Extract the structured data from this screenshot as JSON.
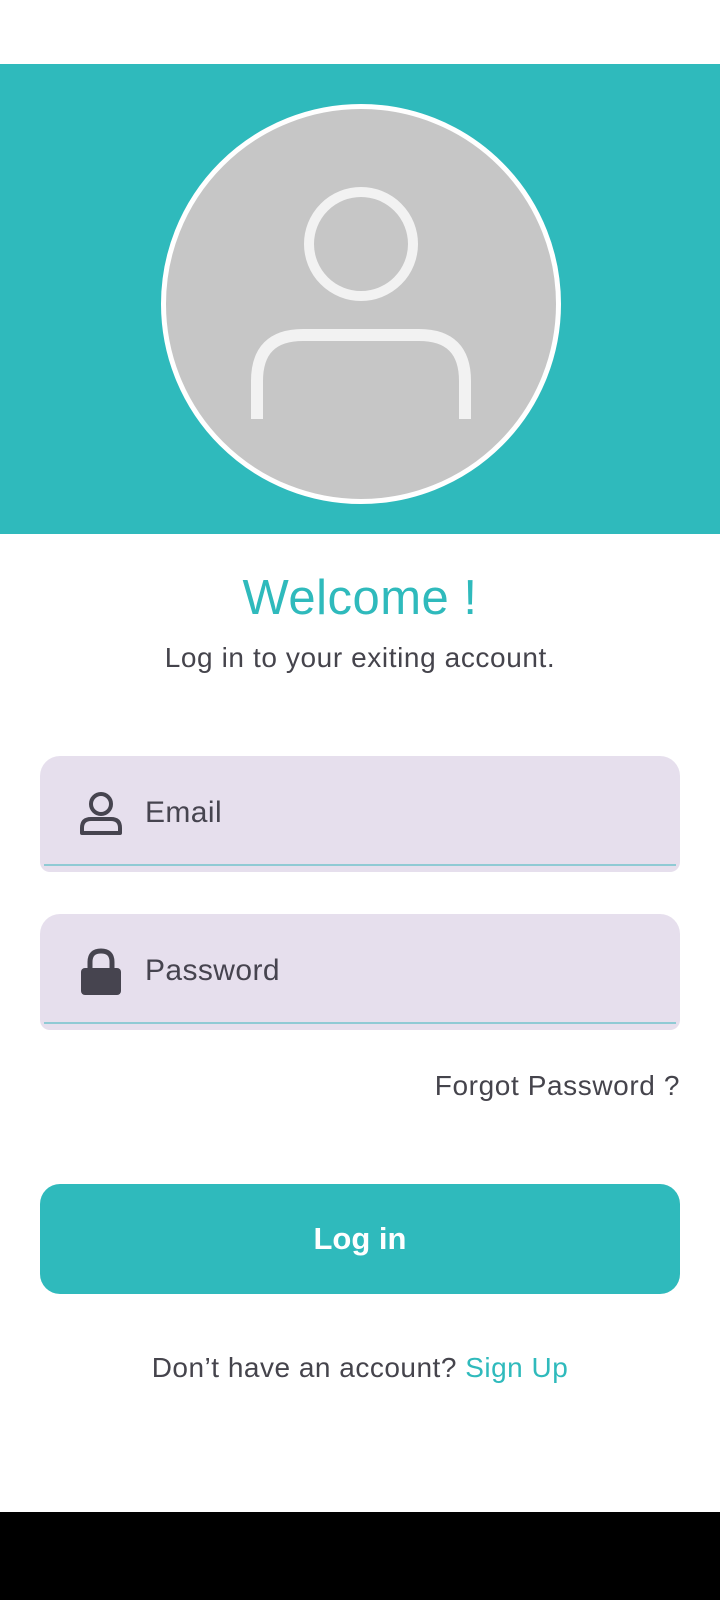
{
  "header": {
    "avatar_icon": "person-placeholder-icon",
    "accent_color": "#2fbabc"
  },
  "welcome": {
    "title": "Welcome !",
    "subtitle": "Log in to your exiting account."
  },
  "form": {
    "email": {
      "placeholder": "Email",
      "icon": "person-icon"
    },
    "password": {
      "placeholder": "Password",
      "icon": "lock-icon"
    },
    "forgot_password": "Forgot Password ?",
    "login_button": "Log in"
  },
  "signup": {
    "prompt": "Don’t have an account?",
    "link": "Sign Up"
  }
}
